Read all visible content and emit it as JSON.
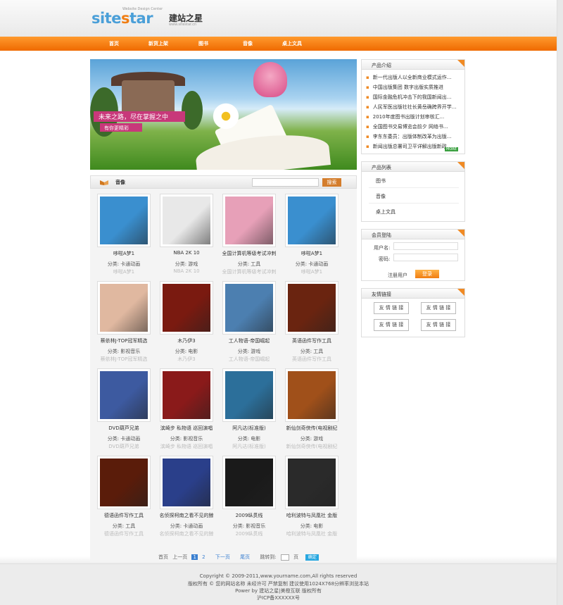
{
  "logo": {
    "brand": "sitestar",
    "cn": "建站之星",
    "tagline": "Website Design Center",
    "url": "www.sitestar.cn"
  },
  "nav": [
    "首页",
    "新货上架",
    "图书",
    "音像",
    "桌上文具"
  ],
  "banner": {
    "slogan": "未来之路，尽在掌握之中",
    "sub": "有你更精彩"
  },
  "music": {
    "title": "音像",
    "search_placeholder": "",
    "search_btn": "搜索"
  },
  "products": [
    {
      "name": "哆啦A梦1",
      "cat": "分类: 卡通动画",
      "faded": "哆啦A梦1",
      "color": "#3a8fcf"
    },
    {
      "name": "NBA 2K 10",
      "cat": "分类: 游戏",
      "faded": "NBA 2K 10",
      "color": "#e8e8e8"
    },
    {
      "name": "全国计算机等级考试冲刺",
      "cat": "分类: 工具",
      "faded": "全国计算机等级考试冲刺",
      "color": "#e7a0b8"
    },
    {
      "name": "哆啦A梦1",
      "cat": "分类: 卡通动画",
      "faded": "哆啦A梦1",
      "color": "#3a8fcf"
    },
    {
      "name": "蔡依林J-TOP冠军精选",
      "cat": "分类: 影视音乐",
      "faded": "蔡依林J-TOP冠军精选",
      "color": "#e0b8a0"
    },
    {
      "name": "木乃伊3",
      "cat": "分类: 电影",
      "faded": "木乃伊3",
      "color": "#7a1a10"
    },
    {
      "name": "工人物语-帝国崛起",
      "cat": "分类: 游戏",
      "faded": "工人物语-帝国崛起",
      "color": "#4c7fb0"
    },
    {
      "name": "英语函件写作工具",
      "cat": "分类: 工具",
      "faded": "英语函件写作工具",
      "color": "#6a2410"
    },
    {
      "name": "DVD葫芦兄弟",
      "cat": "分类: 卡通动画",
      "faded": "DVD葫芦兄弟",
      "color": "#3d5aa0"
    },
    {
      "name": "滨崎步 私物语 巡回演唱",
      "cat": "分类: 影视音乐",
      "faded": "滨崎步 私物语 巡回演唱",
      "color": "#8a1a1a"
    },
    {
      "name": "阿凡达(标准版)",
      "cat": "分类: 电影",
      "faded": "阿凡达(标准版)",
      "color": "#2c6f9a"
    },
    {
      "name": "新仙剑奇侠传(电视剧纪",
      "cat": "分类: 游戏",
      "faded": "新仙剑奇侠传(电视剧纪",
      "color": "#a0501a"
    },
    {
      "name": "德语函件写作工具",
      "cat": "分类: 工具",
      "faded": "德语函件写作工具",
      "color": "#5a1c0a"
    },
    {
      "name": "名侦探柯南之看不见的鲸",
      "cat": "分类: 卡通动画",
      "faded": "名侦探柯南之看不见的鲸",
      "color": "#2a3f8a"
    },
    {
      "name": "2009纵贯线",
      "cat": "分类: 影视音乐",
      "faded": "2009纵贯线",
      "color": "#1a1a1a"
    },
    {
      "name": "哈利波特与凤凰社 金版",
      "cat": "分类: 电影",
      "faded": "哈利波特与凤凰社 金版",
      "color": "#2a2a2a"
    }
  ],
  "pager": {
    "first": "首页",
    "prev": "上一页",
    "p1": "1",
    "p2": "2",
    "next": "下一页",
    "last": "尾页",
    "jump": "跳转到:",
    "unit": "页",
    "go": "确定"
  },
  "sidebar": {
    "intro_title": "产品介绍",
    "news": [
      "新一代出版人以全新商业模式运作...",
      "中国出版集团 数字出版实质推进",
      "国际金融危机冲击下的我国新闻出...",
      "人民军医出版社社长黄岳确跨界开学...",
      "2010年度图书出版计划审核汇...",
      "全国图书交易博览会前夕 网络书...",
      "李东东委员：出版体制改革为出版...",
      "新闻出版总署司卫平详解出版新政..."
    ],
    "more": "MORE",
    "cat_title": "产品列表",
    "cats": [
      "图书",
      "音像",
      "桌上文具"
    ],
    "login_title": "会员登陆",
    "user_label": "用户名:",
    "pass_label": "密码:",
    "register": "注册用户",
    "login_btn": "登录",
    "links_title": "友情链接",
    "links": [
      "友 情 链 接",
      "友 情 链 接",
      "友 情 链 接",
      "友 情 链 接"
    ]
  },
  "footer": [
    "Copyright © 2009-2011,www.yourname.com,All rights reserved",
    "版权所有 © 您的网站名称 未经许可 严禁复制 建议使用1024X768分辨率浏览本站",
    "Power by 建站之星|美橙互联 版权所有",
    "沪ICP备XXXXXX号"
  ]
}
